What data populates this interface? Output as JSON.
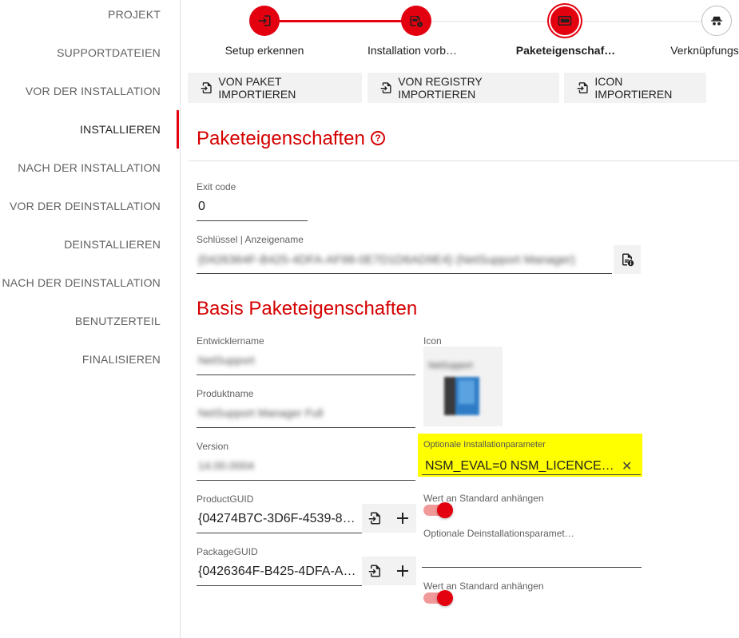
{
  "sidebar": {
    "items": [
      {
        "label": "PROJEKT"
      },
      {
        "label": "SUPPORTDATEIEN"
      },
      {
        "label": "VOR DER INSTALLATION"
      },
      {
        "label": "INSTALLIEREN"
      },
      {
        "label": "NACH DER INSTALLATION"
      },
      {
        "label": "VOR DER DEINSTALLATION"
      },
      {
        "label": "DEINSTALLIEREN"
      },
      {
        "label": "NACH DER DEINSTALLATION"
      },
      {
        "label": "BENUTZERTEIL"
      },
      {
        "label": "FINALISIEREN"
      }
    ],
    "active": "INSTALLIEREN"
  },
  "stepper": {
    "steps": [
      {
        "label": "Setup erkennen",
        "state": "done",
        "icon": "login-icon"
      },
      {
        "label": "Installation vorb…",
        "state": "done",
        "icon": "package-info-icon"
      },
      {
        "label": "Paketeigenschaf…",
        "state": "current",
        "icon": "id-card-icon"
      },
      {
        "label": "Verknüpfungs",
        "state": "todo",
        "icon": "incognito-icon"
      }
    ]
  },
  "toolbar": {
    "import_package": "VON PAKET IMPORTIEREN",
    "import_registry": "VON REGISTRY IMPORTIEREN",
    "import_icon": "ICON IMPORTIEREN"
  },
  "package_properties": {
    "title": "Paketeigenschaften",
    "exit_code_label": "Exit code",
    "exit_code_value": "0",
    "key_label": "Schlüssel | Anzeigename",
    "key_value": "{0426364F-B425-4DFA-AF98-0E7D1D6AD9E4} (NetSupport Manager)"
  },
  "basis_properties": {
    "title": "Basis Paketeigenschaften",
    "developer_label": "Entwicklername",
    "developer_value": "NetSupport",
    "product_label": "Produktname",
    "product_value": "NetSupport Manager Full",
    "version_label": "Version",
    "version_value": "14.00.0004",
    "product_guid_label": "ProductGUID",
    "product_guid_value": "{04274B7C-3D6F-4539-834…",
    "package_guid_label": "PackageGUID",
    "package_guid_value": "{0426364F-B425-4DFA-AF9…",
    "icon_label": "Icon",
    "icon_caption": "NetSupport",
    "opt_install_label": "Optionale Installationparameter",
    "opt_install_value": "NSM_EVAL=0 NSM_LICENCEE=\"…",
    "append_default_1": "Wert an Standard anhängen",
    "opt_uninstall_label": "Optionale Deinstallationsparamet…",
    "opt_uninstall_value": "",
    "append_default_2": "Wert an Standard anhängen"
  },
  "colors": {
    "accent": "#e3000f",
    "heading": "#d50000",
    "highlight": "#ffff00"
  }
}
